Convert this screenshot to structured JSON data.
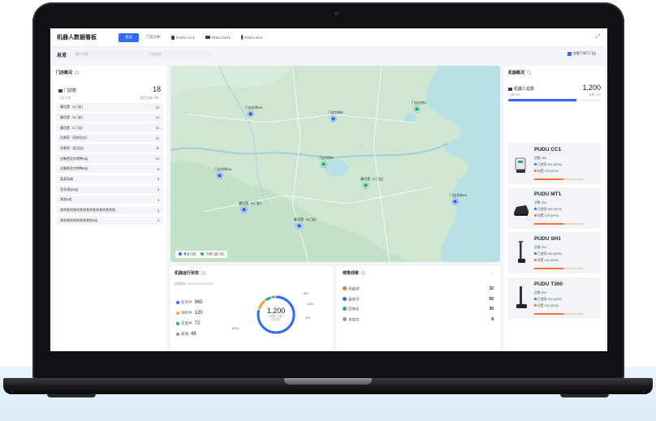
{
  "colors": {
    "accent": "#2f6bff",
    "working": "#2f6bff",
    "idle": "#f7a136",
    "charging": "#22b07d",
    "offline": "#8f959e",
    "map_water": "#b7e0e7",
    "map_land": "#cde6d2"
  },
  "header": {
    "title": "机器人数据看板",
    "tabs": [
      {
        "label": "总览",
        "icon": ""
      },
      {
        "label": "门店分析",
        "icon": ""
      },
      {
        "label": "PUDU CC1",
        "icon": "cleaning-robot-icon"
      },
      {
        "label": "PUDU MT1",
        "icon": "sweeper-robot-icon"
      },
      {
        "label": "PUDU SH1",
        "icon": "scrubber-robot-icon"
      }
    ],
    "expand_icon": "fullscreen-icon"
  },
  "filters": {
    "title": "总览",
    "store_placeholder": "客户名称",
    "robot_placeholder": "门店名称",
    "only_offline": "仅看下线下门店"
  },
  "stores": {
    "title": "门店概况",
    "label": "门店数",
    "count": "18",
    "col_name": "门店名称",
    "col_count": "绑定机器人数 ↕",
    "rows": [
      {
        "name": "童话堡（A门店）",
        "count": "15"
      },
      {
        "name": "童话堡（B门店）",
        "count": "14"
      },
      {
        "name": "童话堡（C门店）",
        "count": "13"
      },
      {
        "name": "台野家（深圳总店）",
        "count": "12"
      },
      {
        "name": "苏野家（武汉店）",
        "count": "11"
      },
      {
        "name": "全聚德北京烤鸭A店",
        "count": "10"
      },
      {
        "name": "全聚德北京烤鸭B店",
        "count": "8"
      },
      {
        "name": "某某私域",
        "count": "5"
      },
      {
        "name": "亚朵酒店A店",
        "count": "3"
      },
      {
        "name": "其他A店",
        "count": "3"
      },
      {
        "name": "其他其他其他其他其他其他其他其他其...",
        "count": "3"
      },
      {
        "name": "其他其他其他其他其他B店",
        "count": "2"
      }
    ]
  },
  "map": {
    "markers": [
      {
        "label": "门店名称AA",
        "color": "#2f6bff"
      },
      {
        "label": "门店名称AA",
        "color": "#2f6bff"
      },
      {
        "label": "门店名称B",
        "color": "#2f6bff"
      },
      {
        "label": "门店名称C",
        "color": "#22b07d"
      },
      {
        "label": "童话堡（A门店）",
        "color": "#2f6bff"
      },
      {
        "label": "童话堡（C门店）",
        "color": "#22b07d"
      },
      {
        "label": "童话堡（B门店）",
        "color": "#2f6bff"
      },
      {
        "label": "门店名称B",
        "color": "#22b07d"
      },
      {
        "label": "门店名称AA",
        "color": "#2f6bff"
      }
    ],
    "legend": [
      {
        "label": "营业门店",
        "color": "#2f6bff"
      },
      {
        "label": "下线门店门店",
        "color": "#22b07d"
      }
    ]
  },
  "robot_status": {
    "title": "机器运行状态",
    "updated": "数据更新 2025.01.05  20:00:05",
    "total": "1,200",
    "total_label": "机器人总数",
    "total_unit": "(已绑定)",
    "items": [
      {
        "label": "任务中",
        "value": "960",
        "pct": "80%",
        "fraction": 0.8,
        "color": "#2f6bff"
      },
      {
        "label": "待机中",
        "value": "120",
        "pct": "10%",
        "fraction": 0.1,
        "color": "#f7a136"
      },
      {
        "label": "充电中",
        "value": "72",
        "pct": "6%",
        "fraction": 0.06,
        "color": "#22b07d"
      },
      {
        "label": "离线",
        "value": "48",
        "pct": "4%",
        "fraction": 0.04,
        "color": "#8f959e"
      }
    ]
  },
  "leads": {
    "title": "销售线索",
    "items": [
      {
        "label": "未跟进",
        "value": "32",
        "icon": "pending-icon",
        "color": "#f77234"
      },
      {
        "label": "跟进中",
        "value": "50",
        "icon": "progress-icon",
        "color": "#2f6bff"
      },
      {
        "label": "已转化",
        "value": "30",
        "icon": "thumbs-up-icon",
        "color": "#22b07d"
      },
      {
        "label": "未成交",
        "value": "8",
        "icon": "closed-icon",
        "color": "#8f959e"
      }
    ]
  },
  "robots": {
    "title": "机器概况",
    "total_label": "机器人总数",
    "total": "1,200",
    "online_label": "已联 880",
    "offline_label": "未联 320",
    "online_fraction": 0.733,
    "cards": [
      {
        "name": "PUDU CC1",
        "total": "总数 400",
        "used": "已使用 900 (60%)",
        "idle": "闲置 100 (60%)",
        "idle_fraction": 0.6
      },
      {
        "name": "PUDU MT1",
        "total": "总数 400",
        "used": "已使用 900 (60%)",
        "idle": "闲置 100 (60%)",
        "idle_fraction": 0.6
      },
      {
        "name": "PUDU SH1",
        "total": "总数 200",
        "used": "已使用 900 (60%)",
        "idle": "闲置 100 (60%)",
        "idle_fraction": 0.6
      },
      {
        "name": "PUDU T300",
        "total": "总数 200",
        "used": "已使用 900 (60%)",
        "idle": "闲置 100 (60%)",
        "idle_fraction": 0.6
      }
    ]
  }
}
